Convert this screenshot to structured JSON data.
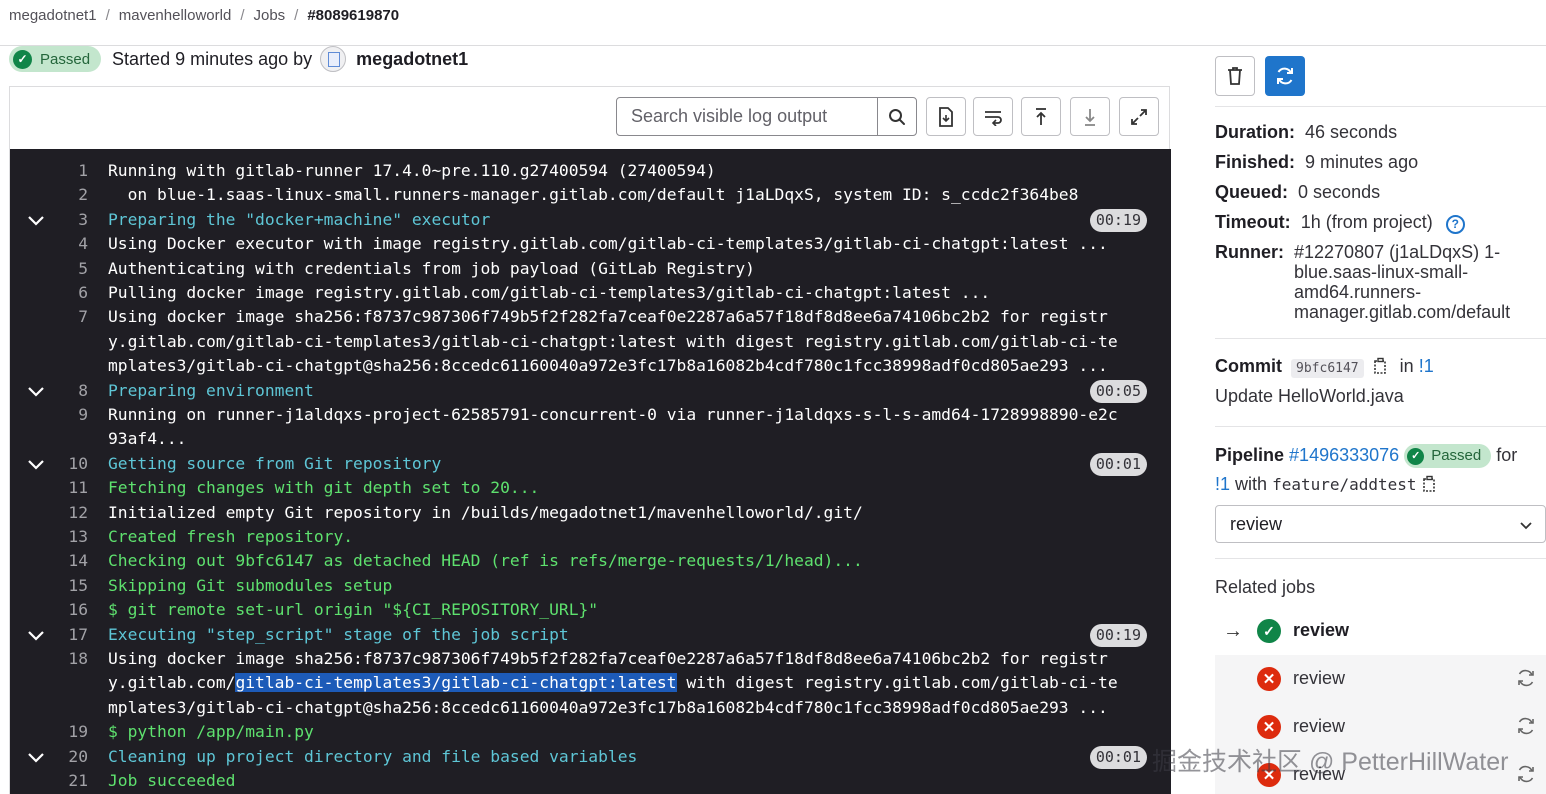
{
  "breadcrumb": {
    "items": [
      "megadotnet1",
      "mavenhelloworld",
      "Jobs"
    ],
    "current": "#8089619870"
  },
  "job_header": {
    "status": "Passed",
    "started_text": "Started 9 minutes ago by",
    "user": "megadotnet1"
  },
  "log_toolbar": {
    "search_placeholder": "Search visible log output"
  },
  "log_lines": [
    {
      "n": "1",
      "text": "Running with gitlab-runner 17.4.0~pre.110.g27400594 (27400594)"
    },
    {
      "n": "2",
      "text": "  on blue-1.saas-linux-small.runners-manager.gitlab.com/default j1aLDqxS, system ID: s_ccdc2f364be8"
    },
    {
      "n": "3",
      "text": "Preparing the \"docker+machine\" executor",
      "time": "00:19"
    },
    {
      "n": "4",
      "text": "Using Docker executor with image registry.gitlab.com/gitlab-ci-templates3/gitlab-ci-chatgpt:latest ..."
    },
    {
      "n": "5",
      "text": "Authenticating with credentials from job payload (GitLab Registry)"
    },
    {
      "n": "6",
      "text": "Pulling docker image registry.gitlab.com/gitlab-ci-templates3/gitlab-ci-chatgpt:latest ..."
    },
    {
      "n": "7",
      "text": "Using docker image sha256:f8737c987306f749b5f2f282fa7ceaf0e2287a6a57f18df8d8ee6a74106bc2b2 for registr"
    },
    {
      "text": "y.gitlab.com/gitlab-ci-templates3/gitlab-ci-chatgpt:latest with digest registry.gitlab.com/gitlab-ci-te"
    },
    {
      "text": "mplates3/gitlab-ci-chatgpt@sha256:8ccedc61160040a972e3fc17b8a16082b4cdf780c1fcc38998adf0cd805ae293 ..."
    },
    {
      "n": "8",
      "text": "Preparing environment",
      "time": "00:05"
    },
    {
      "n": "9",
      "text": "Running on runner-j1aldqxs-project-62585791-concurrent-0 via runner-j1aldqxs-s-l-s-amd64-1728998890-e2c"
    },
    {
      "text": "93af4..."
    },
    {
      "n": "10",
      "text": "Getting source from Git repository",
      "time": "00:01"
    },
    {
      "n": "11",
      "text": "Fetching changes with git depth set to 20..."
    },
    {
      "n": "12",
      "text": "Initialized empty Git repository in /builds/megadotnet1/mavenhelloworld/.git/"
    },
    {
      "n": "13",
      "text": "Created fresh repository."
    },
    {
      "n": "14",
      "text": "Checking out 9bfc6147 as detached HEAD (ref is refs/merge-requests/1/head)..."
    },
    {
      "n": "15",
      "text": "Skipping Git submodules setup"
    },
    {
      "n": "16",
      "text": "$ git remote set-url origin \"${CI_REPOSITORY_URL}\""
    },
    {
      "n": "17",
      "text": "Executing \"step_script\" stage of the job script",
      "time": "00:19"
    },
    {
      "n": "18",
      "text": "Using docker image sha256:f8737c987306f749b5f2f282fa7ceaf0e2287a6a57f18df8d8ee6a74106bc2b2 for registr"
    },
    {
      "pre": "y.gitlab.com/",
      "highlight": "gitlab-ci-templates3/gitlab-ci-chatgpt:latest",
      "post": " with digest registry.gitlab.com/gitlab-ci-te"
    },
    {
      "text": "mplates3/gitlab-ci-chatgpt@sha256:8ccedc61160040a972e3fc17b8a16082b4cdf780c1fcc38998adf0cd805ae293 ..."
    },
    {
      "n": "19",
      "text": "$ python /app/main.py"
    },
    {
      "n": "20",
      "text": "Cleaning up project directory and file based variables",
      "time": "00:01"
    },
    {
      "n": "21",
      "text": "Job succeeded"
    }
  ],
  "sidebar": {
    "duration_label": "Duration:",
    "duration": "46 seconds",
    "finished_label": "Finished:",
    "finished": "9 minutes ago",
    "queued_label": "Queued:",
    "queued": "0 seconds",
    "timeout_label": "Timeout:",
    "timeout": "1h (from project)",
    "runner_label": "Runner:",
    "runner": "#12270807 (j1aLDqxS) 1-blue.saas-linux-small-amd64.runners-manager.gitlab.com/default",
    "commit_label": "Commit",
    "commit_sha": "9bfc6147",
    "commit_in": "in",
    "commit_mr": "!1",
    "commit_message": "Update HelloWorld.java",
    "pipeline_label": "Pipeline",
    "pipeline_id": "#1496333076",
    "pipeline_status": "Passed",
    "pipeline_for": "for",
    "pipeline_mr": "!1",
    "pipeline_with": "with",
    "pipeline_branch": "feature/addtest",
    "stage_select": "review",
    "related_jobs_title": "Related jobs",
    "related_jobs": [
      {
        "name": "review",
        "status": "passed"
      },
      {
        "name": "review",
        "status": "failed"
      },
      {
        "name": "review",
        "status": "failed"
      },
      {
        "name": "review",
        "status": "failed"
      }
    ]
  },
  "watermark": "掘金技术社区 @ PetterHillWater",
  "colors": {
    "log_bg": "#1f1e24",
    "cyan": "#5ec6d6",
    "green": "#5ee16e",
    "accent": "#1f75cb",
    "success": "#108548",
    "danger": "#dd2b0e"
  }
}
